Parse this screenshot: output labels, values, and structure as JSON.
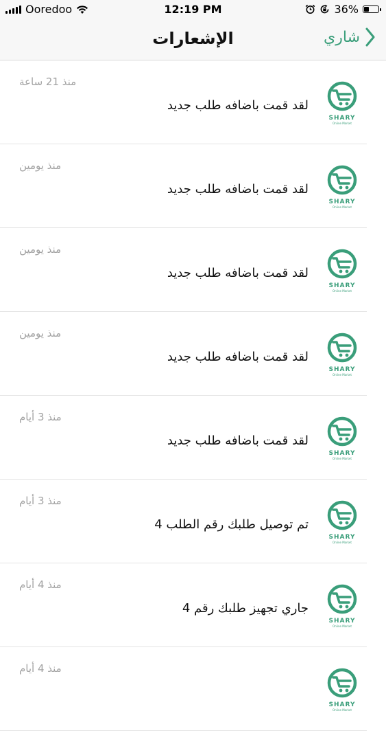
{
  "status_bar": {
    "carrier": "Ooredoo",
    "time": "12:19 PM",
    "battery": "36%",
    "battery_level": 0.36
  },
  "nav": {
    "title": "الإشعارات",
    "back_label": "شاري"
  },
  "logo": {
    "brand": "SHARY",
    "tagline": "Online Market"
  },
  "notifications": [
    {
      "message": "لقد قمت باضافه طلب جديد",
      "time": "منذ 21 ساعة"
    },
    {
      "message": "لقد قمت باضافه طلب جديد",
      "time": "منذ يومين"
    },
    {
      "message": "لقد قمت باضافه طلب جديد",
      "time": "منذ يومين"
    },
    {
      "message": "لقد قمت باضافه طلب جديد",
      "time": "منذ يومين"
    },
    {
      "message": "لقد قمت باضافه طلب جديد",
      "time": "منذ 3 أيام"
    },
    {
      "message": "تم توصيل طلبك رقم الطلب  4",
      "time": "منذ 3 أيام"
    },
    {
      "message": "جاري تجهيز طلبك رقم 4",
      "time": "منذ 4 أيام"
    },
    {
      "message": "",
      "time": "منذ 4 أيام"
    }
  ],
  "colors": {
    "accent": "#3a9e7a",
    "muted_text": "#a2a2a2",
    "bar_background": "#f7f7f7"
  }
}
